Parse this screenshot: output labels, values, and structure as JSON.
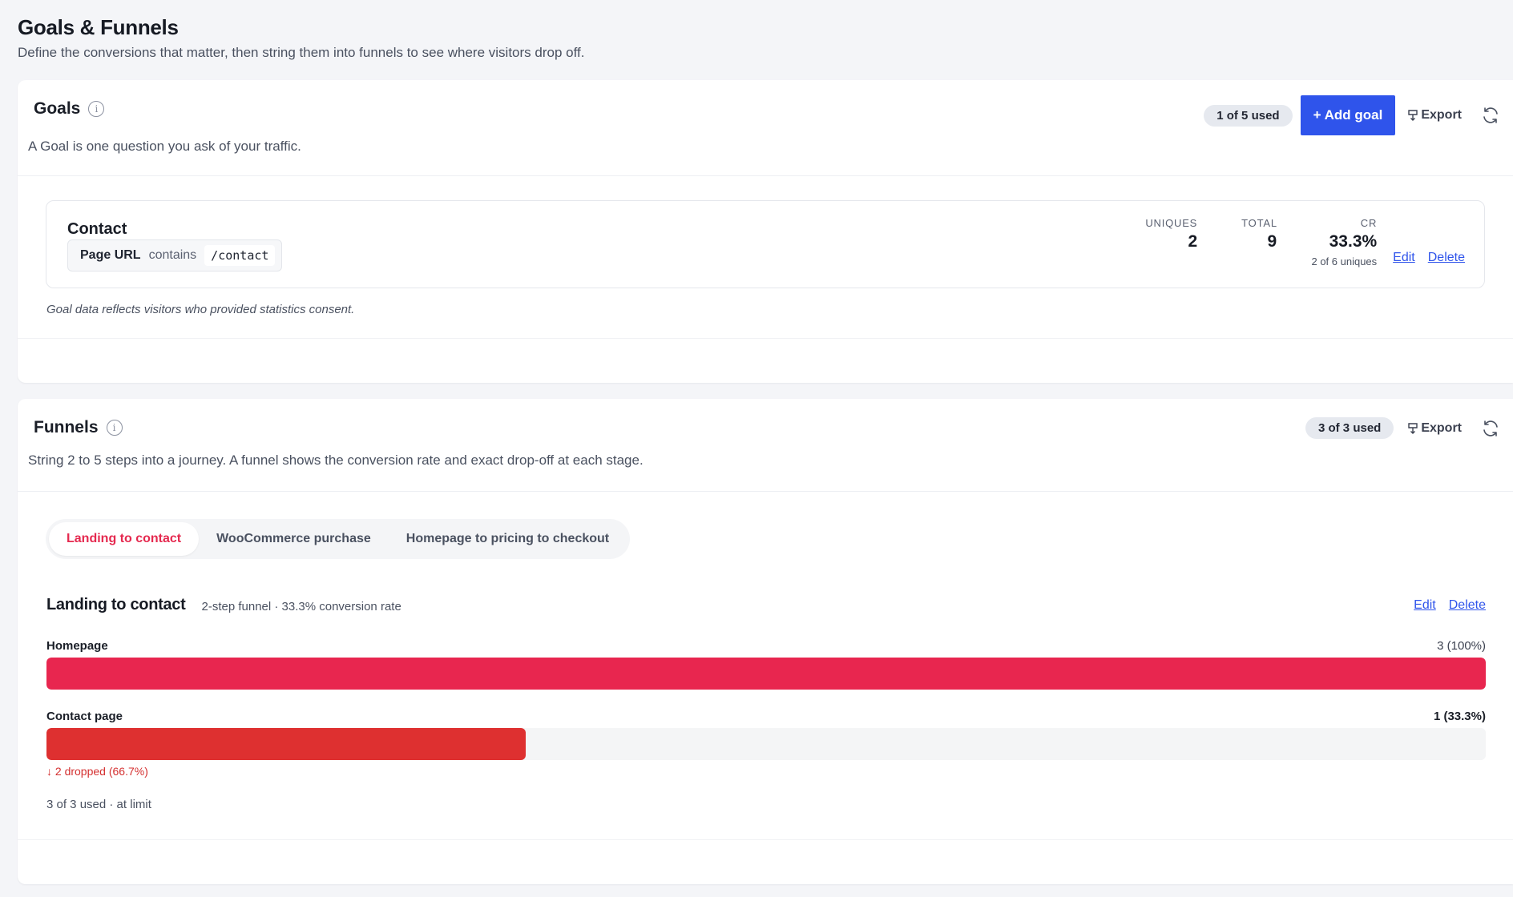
{
  "page": {
    "title": "Goals & Funnels",
    "subtitle": "Define the conversions that matter, then string them into funnels to see where visitors drop off."
  },
  "goals": {
    "title": "Goals",
    "usage_badge": "1 of 5 used",
    "add_button": "+ Add goal",
    "export_label": "Export",
    "description": "A Goal is one question you ask of your traffic.",
    "items": [
      {
        "name": "Contact",
        "rule": {
          "field": "Page URL",
          "operator": "contains",
          "value": "/contact"
        },
        "uniques_label": "UNIQUES",
        "uniques": "2",
        "total_label": "TOTAL",
        "total": "9",
        "cr_label": "CR",
        "cr": "33.3%",
        "cr_sub": "2 of 6 uniques",
        "edit_label": "Edit",
        "delete_label": "Delete"
      }
    ],
    "consent_note": "Goal data reflects visitors who provided statistics consent."
  },
  "funnels": {
    "title": "Funnels",
    "usage_badge": "3 of 3 used",
    "export_label": "Export",
    "description": "String 2 to 5 steps into a journey. A funnel shows the conversion rate and exact drop-off at each stage.",
    "tabs": [
      {
        "label": "Landing to contact",
        "active": true
      },
      {
        "label": "WooCommerce purchase",
        "active": false
      },
      {
        "label": "Homepage to pricing to checkout",
        "active": false
      }
    ],
    "selected": {
      "name": "Landing to contact",
      "meta": "2-step funnel · 33.3% conversion rate",
      "edit_label": "Edit",
      "delete_label": "Delete",
      "steps": [
        {
          "name": "Homepage",
          "count": "3  (100%)",
          "fraction": 1.0,
          "color": "#e8264f"
        },
        {
          "name": "Contact page",
          "count": "1  (33.3%)",
          "fraction": 0.333,
          "color": "#de3030",
          "dropoff": "↓ 2 dropped (66.7%)"
        }
      ]
    },
    "limit_note": "3 of 3 used · at limit"
  },
  "colors": {
    "accent": "#2f54eb",
    "tab_active": "#e5294f",
    "step1_bar": "#e8264f",
    "step2_bar": "#de3030",
    "dropoff": "#d43030"
  }
}
